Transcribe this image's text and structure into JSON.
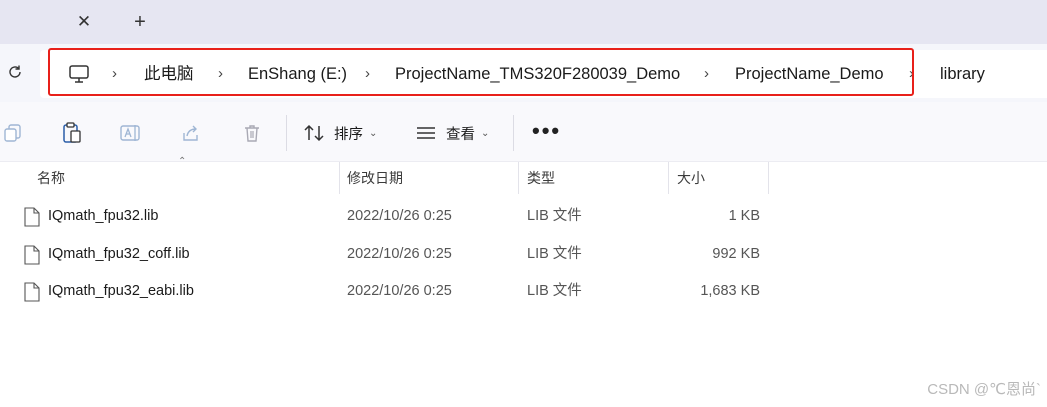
{
  "tabs": {
    "close_glyph": "✕",
    "new_glyph": "+"
  },
  "breadcrumb": {
    "items": [
      {
        "label": "此电脑"
      },
      {
        "label": "EnShang (E:)"
      },
      {
        "label": "ProjectName_TMS320F280039_Demo"
      },
      {
        "label": "ProjectName_Demo"
      },
      {
        "label": "library"
      }
    ],
    "separator": "›",
    "highlight_color": "#e8201a"
  },
  "toolbar": {
    "icons": [
      "copy-icon",
      "paste-icon",
      "rename-icon",
      "share-icon",
      "delete-icon"
    ],
    "sort_label": "排序",
    "view_label": "查看",
    "more_label": "•••"
  },
  "columns": {
    "name": "名称",
    "date": "修改日期",
    "type": "类型",
    "size": "大小"
  },
  "files": [
    {
      "name": "IQmath_fpu32.lib",
      "date": "2022/10/26 0:25",
      "type": "LIB 文件",
      "size": "1 KB"
    },
    {
      "name": "IQmath_fpu32_coff.lib",
      "date": "2022/10/26 0:25",
      "type": "LIB 文件",
      "size": "992 KB"
    },
    {
      "name": "IQmath_fpu32_eabi.lib",
      "date": "2022/10/26 0:25",
      "type": "LIB 文件",
      "size": "1,683 KB"
    }
  ],
  "watermark": "CSDN @℃恩尚`"
}
